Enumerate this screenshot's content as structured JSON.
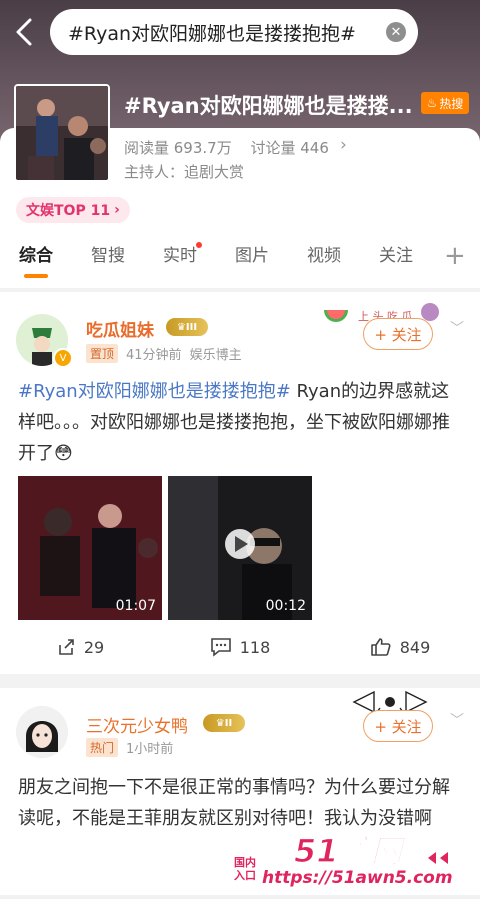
{
  "search": {
    "query": "#Ryan对欧阳娜娜也是搂搂抱抱#"
  },
  "topic": {
    "title": "#Ryan对欧阳娜娜也是搂搂...",
    "hot_badge": "热搜",
    "reads": "阅读量 693.7万",
    "discussions": "讨论量 446",
    "host": "主持人：追剧大赏",
    "rank": "文娱TOP 11"
  },
  "tabs": [
    "综合",
    "智搜",
    "实时",
    "图片",
    "视频",
    "关注"
  ],
  "post1": {
    "username": "吃瓜姐妹",
    "level": "III",
    "pin_tag": "置顶",
    "time": "41分钟前",
    "source": "娱乐博主",
    "follow": "+ 关注",
    "hashtag": "#Ryan对欧阳娜娜也是搂搂抱抱#",
    "text_rest": " Ryan的边界感就这样吧。。。对欧阳娜娜也是搂搂抱抱，坐下被欧阳娜娜推开了",
    "video1_duration": "01:07",
    "video2_duration": "00:12",
    "shares": "29",
    "comments": "118",
    "likes": "849"
  },
  "post2": {
    "username": "三次元少女鸭",
    "level": "II",
    "hot_tag": "热门",
    "time": "1小时前",
    "follow": "+ 关注",
    "text": "朋友之间抱一下不是很正常的事情吗？为什么要过分解读呢，不能是王菲朋友就区别对待吧！我认为没错啊"
  },
  "watermark": {
    "logo": "51暗网",
    "line1": "国内",
    "line2": "入口",
    "url": "https://51awn5.com"
  }
}
